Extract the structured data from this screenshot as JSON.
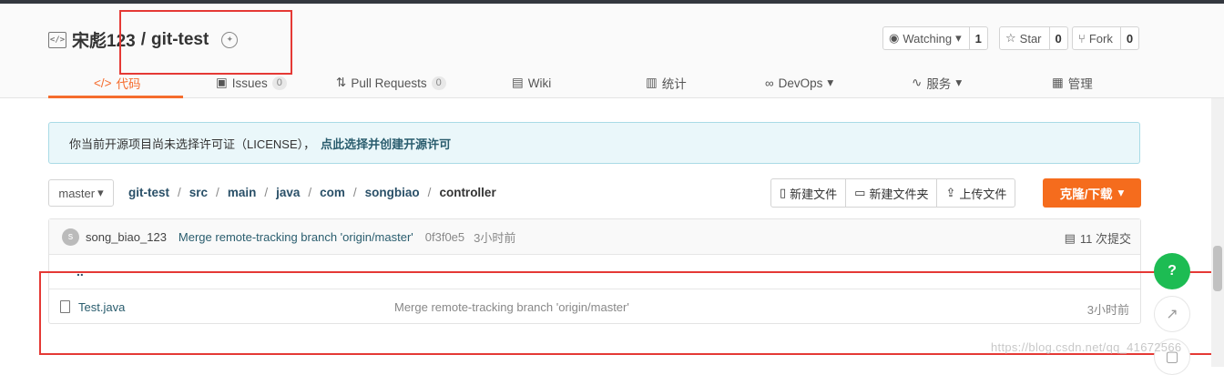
{
  "repo": {
    "owner": "宋彪123",
    "separator": "/",
    "name": "git-test"
  },
  "actions": [
    {
      "label": "Watching",
      "count": "1",
      "icon": "eye-icon"
    },
    {
      "label": "Star",
      "count": "0",
      "icon": "star-icon"
    },
    {
      "label": "Fork",
      "count": "0",
      "icon": "fork-icon"
    }
  ],
  "tabs": [
    {
      "label": "代码",
      "icon": "code-icon"
    },
    {
      "label": "Issues",
      "count": "0",
      "icon": "issues-icon"
    },
    {
      "label": "Pull Requests",
      "count": "0",
      "icon": "pull-request-icon"
    },
    {
      "label": "Wiki",
      "icon": "wiki-icon"
    },
    {
      "label": "统计",
      "icon": "chart-icon"
    },
    {
      "label": "DevOps",
      "icon": "devops-icon"
    },
    {
      "label": "服务",
      "icon": "pulse-icon"
    },
    {
      "label": "管理",
      "icon": "manage-icon"
    }
  ],
  "notice": {
    "text": "你当前开源项目尚未选择许可证（LICENSE），",
    "link": "点此选择并创建开源许可"
  },
  "branch": "master",
  "breadcrumb": [
    "git-test",
    "src",
    "main",
    "java",
    "com",
    "songbiao",
    "controller"
  ],
  "file_buttons": [
    "新建文件",
    "新建文件夹",
    "上传文件"
  ],
  "clone_label": "克隆/下载",
  "commit": {
    "avatar_letter": "s",
    "author": "song_biao_123",
    "message": "Merge remote-tracking branch 'origin/master'",
    "hash": "0f3f0e5",
    "time": "3小时前",
    "count": "11 次提交"
  },
  "parent_link": "..",
  "files": [
    {
      "name": "Test.java",
      "message": "Merge remote-tracking branch 'origin/master'",
      "time": "3小时前"
    }
  ],
  "float_help": "?",
  "watermark": "https://blog.csdn.net/qq_41672566",
  "colors": {
    "accent": "#f56c2d",
    "clone": "#f56c1d",
    "help": "#1dbc53",
    "annotation": "#e53935"
  }
}
